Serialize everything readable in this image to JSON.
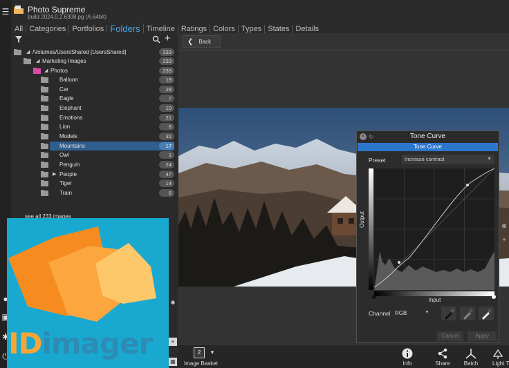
{
  "app": {
    "title": "Photo Supreme",
    "build": "build 2024.0.2.6308.pg (A.64bit)"
  },
  "tabs": [
    {
      "label": "All",
      "active": false
    },
    {
      "label": "Categories",
      "active": false
    },
    {
      "label": "Portfolios",
      "active": false
    },
    {
      "label": "Folders",
      "active": true
    },
    {
      "label": "Timeline",
      "active": false
    },
    {
      "label": "Ratings",
      "active": false
    },
    {
      "label": "Colors",
      "active": false
    },
    {
      "label": "Types",
      "active": false
    },
    {
      "label": "States",
      "active": false
    },
    {
      "label": "Details",
      "active": false
    }
  ],
  "tree": {
    "root": {
      "label": "/Volumes/UsersShared  [UsersShared]",
      "count": "233"
    },
    "marketing": {
      "label": "Marketing Images",
      "count": "233"
    },
    "photos": {
      "label": "Photos",
      "count": "233"
    },
    "folders": [
      {
        "label": "Balloon",
        "count": "19"
      },
      {
        "label": "Car",
        "count": "28"
      },
      {
        "label": "Eagle",
        "count": "7"
      },
      {
        "label": "Elephant",
        "count": "10"
      },
      {
        "label": "Emotions",
        "count": "21"
      },
      {
        "label": "Lion",
        "count": "8"
      },
      {
        "label": "Models",
        "count": "31"
      },
      {
        "label": "Mountains",
        "count": "17",
        "selected": true
      },
      {
        "label": "Owl",
        "count": "1"
      },
      {
        "label": "Penguin",
        "count": "24"
      },
      {
        "label": "People",
        "count": "47",
        "expandable": true
      },
      {
        "label": "Tiger",
        "count": "14"
      },
      {
        "label": "Train",
        "count": "6"
      }
    ],
    "see_all": "see all 233 images"
  },
  "main": {
    "back_label": "Back"
  },
  "tone_curve": {
    "window_title": "Tone Curve",
    "tab_label": "Tone Curve",
    "preset_label": "Preset",
    "preset_value": "Increase contrast",
    "output_label": "Output",
    "input_label": "Input",
    "channel_label": "Channel",
    "channel_value": "RGB",
    "cancel_label": "Cancel",
    "apply_label": "Apply"
  },
  "bottom": {
    "basket_count": "2",
    "basket_label": "Image Basket",
    "info_label": "Info",
    "share_label": "Share",
    "batch_label": "Batch",
    "light_table_label": "Light Ta"
  },
  "logo": {
    "text_i": "ID",
    "text_rest": "imager"
  },
  "colors": {
    "accent_blue": "#4aa6e6",
    "selection": "#2f5e8f",
    "logo_bg": "#19a9d0",
    "logo_orange": "#f7a535"
  }
}
